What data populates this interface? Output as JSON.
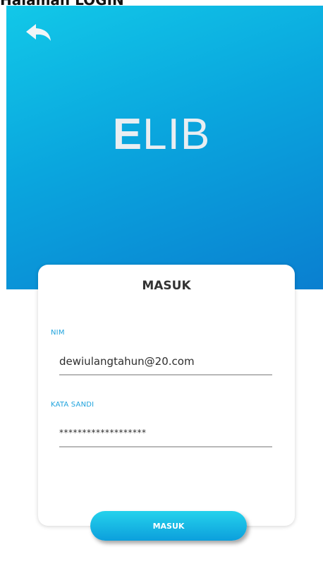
{
  "doc": {
    "heading": "Halaman LOGIN"
  },
  "header": {
    "logo_first": "E",
    "logo_rest": "LIB"
  },
  "card": {
    "title": "MASUK",
    "nim": {
      "label": "NIM",
      "value": "dewiulangtahun@20.com"
    },
    "password": {
      "label": "KATA SANDI",
      "value": "*******************"
    }
  },
  "login_button": {
    "label": "MASUK"
  },
  "colors": {
    "accent": "#12c8e8",
    "accent_dark": "#0a7fd0",
    "label_blue": "#1fa3dd"
  },
  "icons": {
    "back": "back-arrow-icon"
  }
}
